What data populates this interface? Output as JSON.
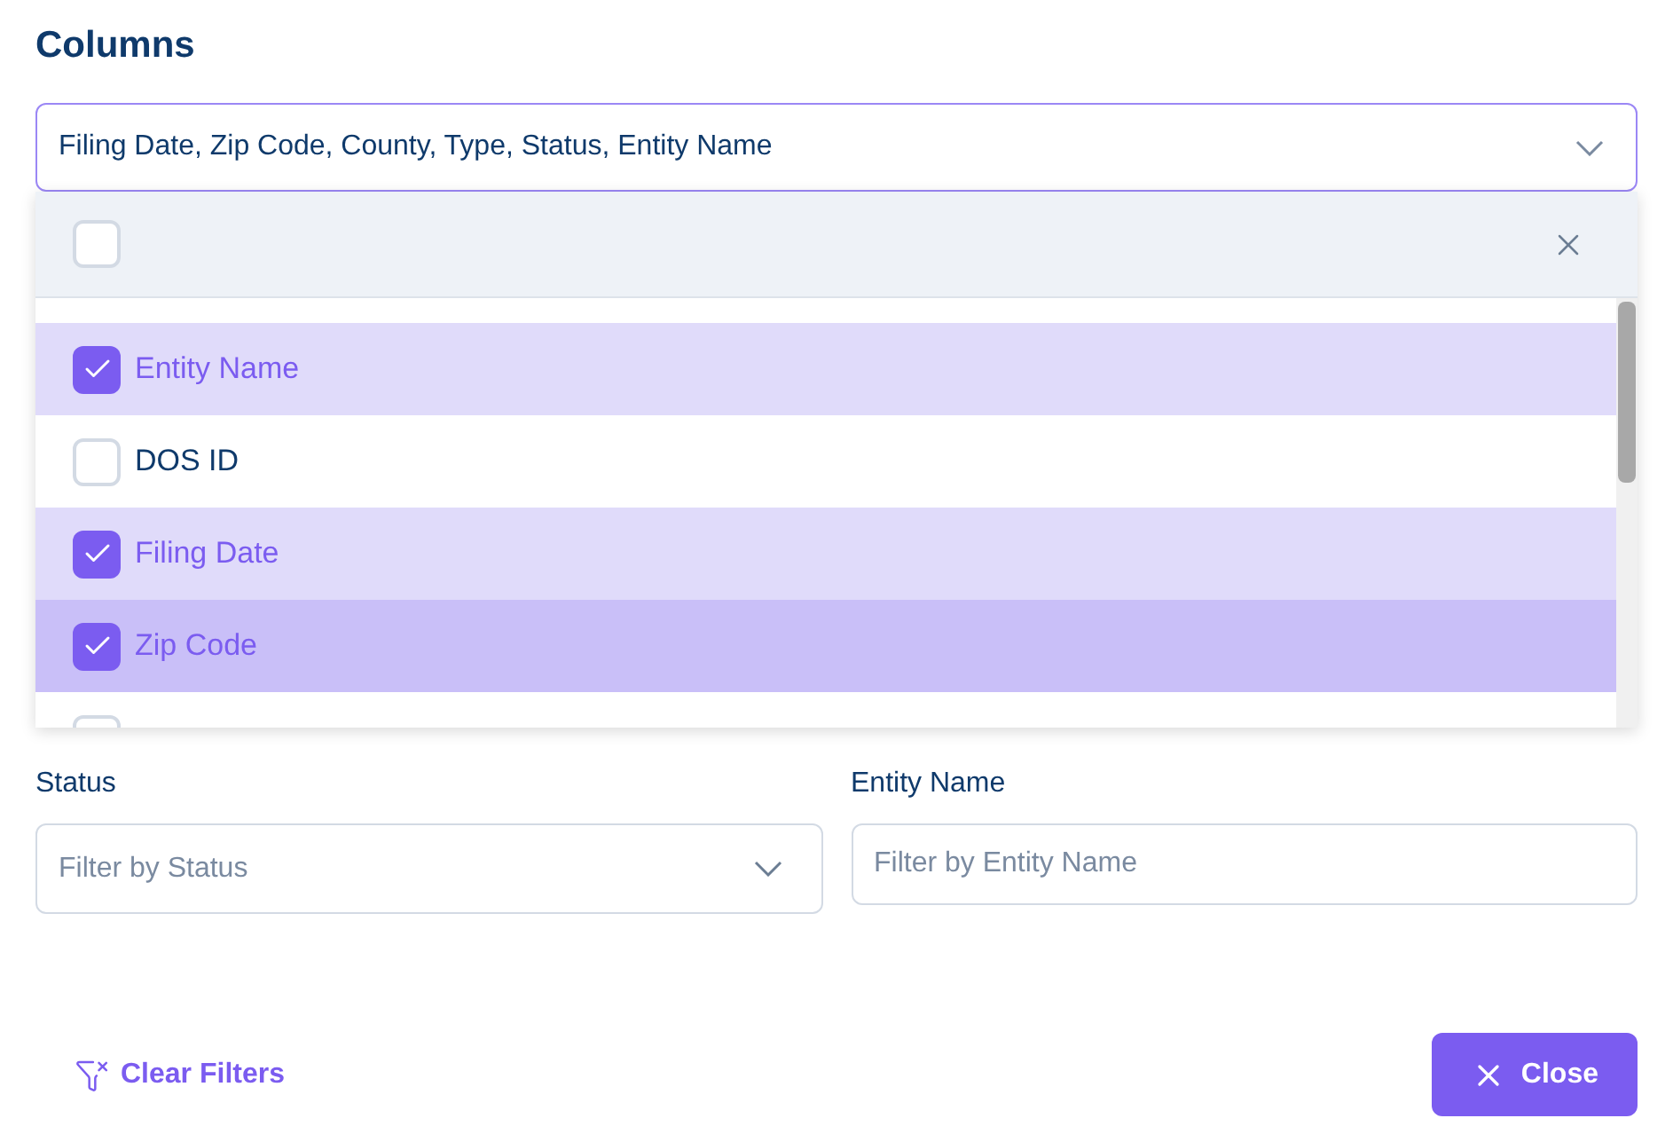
{
  "heading": "Columns",
  "columns_select": {
    "value": "Filing Date, Zip Code, County, Type, Status, Entity Name",
    "expanded": true
  },
  "menu": {
    "select_all": {
      "checked": false
    },
    "options": [
      {
        "label": "Entity Name",
        "checked": true,
        "highlighted": false
      },
      {
        "label": "DOS ID",
        "checked": false,
        "highlighted": false
      },
      {
        "label": "Filing Date",
        "checked": true,
        "highlighted": false
      },
      {
        "label": "Zip Code",
        "checked": true,
        "highlighted": true
      }
    ],
    "partial_option": {
      "checked": false
    }
  },
  "filters": [
    {
      "kind": "select",
      "label": "Status",
      "placeholder": "Filter by Status"
    },
    {
      "kind": "text",
      "label": "Entity Name",
      "placeholder": "Filter by Entity Name"
    }
  ],
  "clear_button": "Clear Filters",
  "close_button": "Close"
}
